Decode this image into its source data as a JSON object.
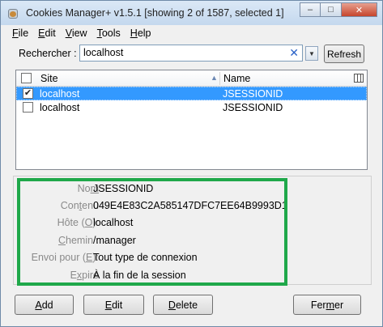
{
  "window": {
    "title": "Cookies Manager+ v1.5.1 [showing 2 of 1587, selected 1]",
    "minimize_glyph": "‒",
    "maximize_glyph": "□",
    "close_glyph": "✕"
  },
  "menu": [
    {
      "key": "F",
      "rest": "ile"
    },
    {
      "key": "E",
      "rest": "dit"
    },
    {
      "key": "V",
      "rest": "iew"
    },
    {
      "key": "T",
      "rest": "ools"
    },
    {
      "key": "H",
      "rest": "elp"
    }
  ],
  "search": {
    "label": "Rechercher :",
    "value": "localhost",
    "clear_glyph": "✕",
    "dropdown_glyph": "▼",
    "refresh_label": "Refresh"
  },
  "list": {
    "columns": {
      "site": "Site",
      "name": "Name",
      "sort_glyph": "▲"
    },
    "rows": [
      {
        "checked": "✔",
        "site": "localhost",
        "name": "JSESSIONID",
        "selected": true
      },
      {
        "checked": "",
        "site": "localhost",
        "name": "JSESSIONID",
        "selected": false
      }
    ]
  },
  "details": {
    "fields": [
      {
        "pre": "No",
        "key": "m",
        "post": "",
        "value": "JSESSIONID"
      },
      {
        "pre": "Con",
        "key": "t",
        "post": "enu",
        "value": "049E4E83C2A585147DFC7EE64B9993D1"
      },
      {
        "pre": "Hôte (",
        "key": "O",
        "post": "):",
        "value": "localhost"
      },
      {
        "pre": "",
        "key": "C",
        "post": "hemin :",
        "value": "/manager"
      },
      {
        "pre": "Envoi pour (",
        "key": "E",
        "post": "):",
        "value": "Tout type de connexion"
      },
      {
        "pre": "E",
        "key": "x",
        "post": "pire",
        "value": "À la fin de la session"
      }
    ],
    "highlight_color": "#1fa84a"
  },
  "buttons": {
    "add": {
      "key": "A",
      "rest": "dd"
    },
    "edit": {
      "key": "E",
      "rest": "dit"
    },
    "delete": {
      "key": "D",
      "rest": "elete"
    },
    "close": {
      "pre": "Fer",
      "key": "m",
      "post": "er"
    }
  },
  "colors": {
    "selection": "#3399ff",
    "titlebar": "#c4d8ee"
  }
}
